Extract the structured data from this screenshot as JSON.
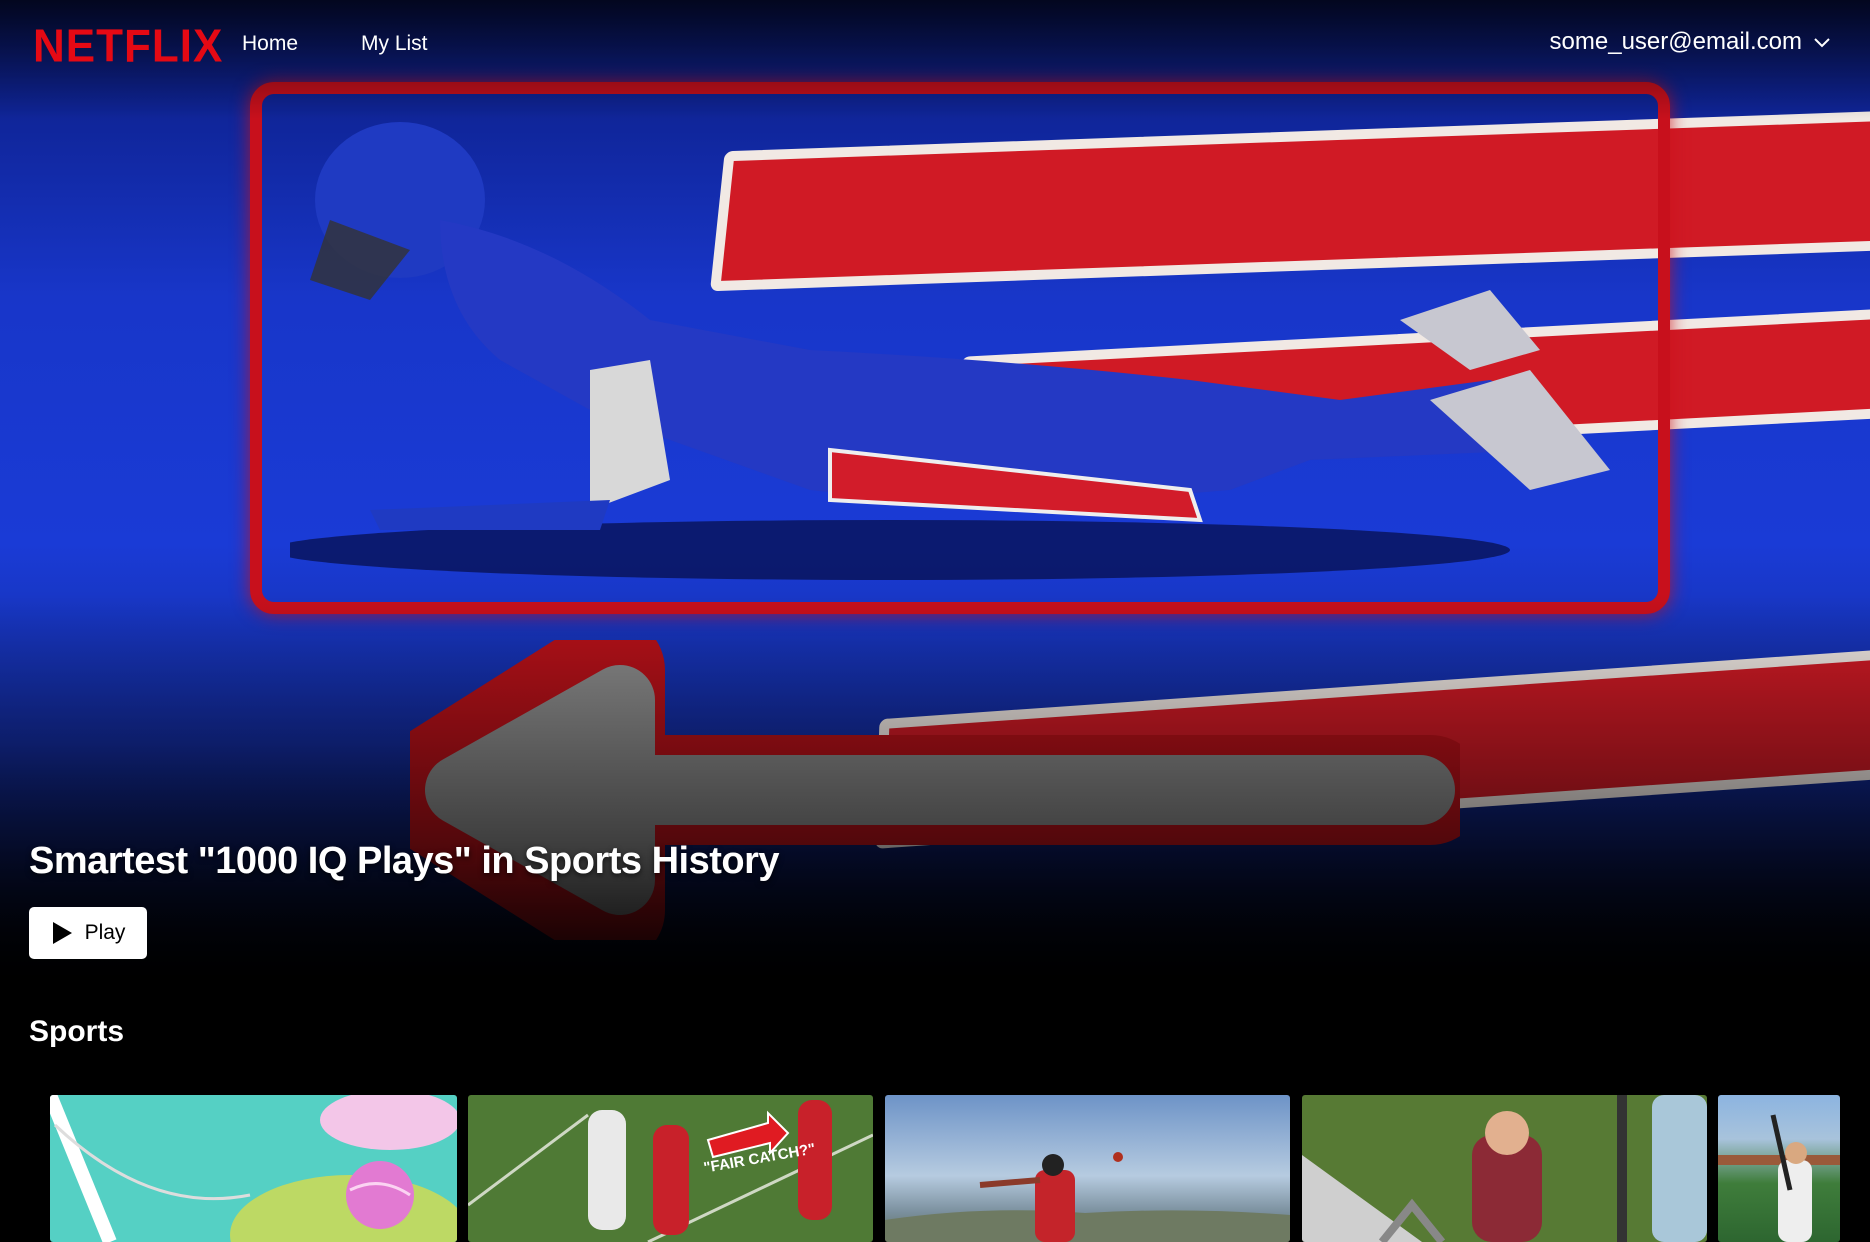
{
  "nav": {
    "logo": "NETFLIX",
    "links": [
      "Home",
      "My List"
    ],
    "account_email": "some_user@email.com"
  },
  "hero": {
    "title": "Smartest \"1000 IQ Plays\" in Sports History",
    "play_label": "Play"
  },
  "rows": [
    {
      "title": "Sports",
      "thumbnails": [
        {
          "name": "tennis-illustration"
        },
        {
          "name": "football-fair-catch",
          "overlay_text": "\"FAIR CATCH?\""
        },
        {
          "name": "baseball-batter-sky"
        },
        {
          "name": "surprised-woman-yard"
        },
        {
          "name": "baseball-player-field"
        }
      ]
    }
  ],
  "colors": {
    "brand": "#e50914",
    "background": "#000000",
    "highlight": "#c8101c"
  },
  "icons": [
    "chevron-down-icon",
    "play-icon"
  ]
}
